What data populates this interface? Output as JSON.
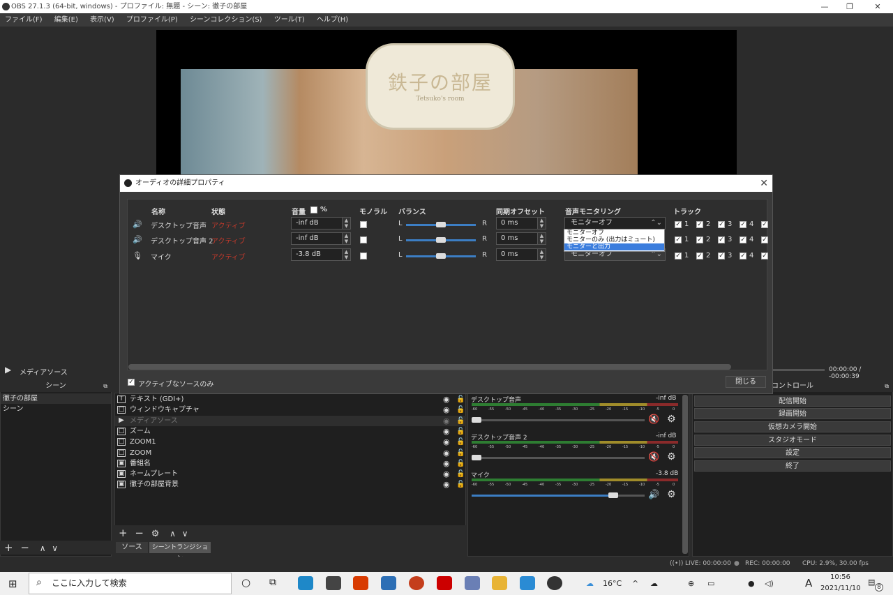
{
  "window": {
    "title": "OBS 27.1.3 (64-bit, windows) - プロファイル: 無題 - シーン: 徹子の部屋",
    "min": "—",
    "max": "❐",
    "close": "✕"
  },
  "menu": [
    "ファイル(F)",
    "編集(E)",
    "表示(V)",
    "プロファイル(P)",
    "シーンコレクション(S)",
    "ツール(T)",
    "ヘルプ(H)"
  ],
  "preview": {
    "logo_title": "鉄子の部屋",
    "logo_sub": "Tetsuko's room"
  },
  "dialog": {
    "title": "オーディオの詳細プロパティ",
    "close_icon": "✕",
    "headers": {
      "name": "名称",
      "status": "状態",
      "volume": "音量",
      "percent": "%",
      "mono": "モノラル",
      "balance": "バランス",
      "sync": "同期オフセット",
      "monitor": "音声モニタリング",
      "tracks": "トラック"
    },
    "rows": [
      {
        "icon": "speaker-icon",
        "name": "デスクトップ音声",
        "status": "アクティブ",
        "volume": "-inf dB",
        "bal_l": "L",
        "bal_r": "R",
        "balance": 0.5,
        "sync": "0 ms",
        "monitor": "モニターオフ",
        "tracks": [
          "1",
          "2",
          "3",
          "4"
        ]
      },
      {
        "icon": "speaker-icon",
        "name": "デスクトップ音声 2",
        "status": "アクティブ",
        "volume": "-inf dB",
        "bal_l": "L",
        "bal_r": "R",
        "balance": 0.5,
        "sync": "0 ms",
        "monitor": "",
        "tracks": [
          "1",
          "2",
          "3",
          "4"
        ]
      },
      {
        "icon": "mic-icon",
        "name": "マイク",
        "status": "アクティブ",
        "volume": "-3.8 dB",
        "bal_l": "L",
        "bal_r": "R",
        "balance": 0.5,
        "sync": "0 ms",
        "monitor": "モニターオフ",
        "tracks": [
          "1",
          "2",
          "3",
          "4"
        ]
      }
    ],
    "dropdown_options": [
      "モニターオフ",
      "モニターのみ (出力はミュート)",
      "モニターと出力"
    ],
    "dropdown_selected": "モニターと出力",
    "active_only_label": "アクティブなソースのみ",
    "close_button": "閉じる"
  },
  "media": {
    "name": "メディアソース",
    "time": "00:00:00 / -00:00:39"
  },
  "scenes": {
    "header": "シーン",
    "items": [
      "徹子の部屋",
      "シーン"
    ]
  },
  "sources": {
    "items": [
      {
        "icon": "T",
        "label": "テキスト (GDI+)"
      },
      {
        "icon": "□",
        "label": "ウィンドウキャプチャ"
      },
      {
        "icon": "▶",
        "label": "メディアソース",
        "hidden": true
      },
      {
        "icon": "□",
        "label": "ズーム"
      },
      {
        "icon": "□",
        "label": "ZOOM1"
      },
      {
        "icon": "□",
        "label": "ZOOM"
      },
      {
        "icon": "▣",
        "label": "番組名"
      },
      {
        "icon": "▣",
        "label": "ネームプレート"
      },
      {
        "icon": "▣",
        "label": "徹子の部屋背景"
      }
    ],
    "tab_sources": "ソース",
    "tab_transitions": "シーントランジション"
  },
  "mixer": {
    "ticks": [
      "-60",
      "-55",
      "-50",
      "-45",
      "-40",
      "-35",
      "-30",
      "-25",
      "-20",
      "-15",
      "-10",
      "-5",
      "0"
    ],
    "channels": [
      {
        "name": "デスクトップ音声",
        "value": "-inf dB",
        "level": 0.0,
        "muted": true
      },
      {
        "name": "デスクトップ音声 2",
        "value": "-inf dB",
        "level": 0.0,
        "muted": true
      },
      {
        "name": "マイク",
        "value": "-3.8 dB",
        "level": 0.82,
        "muted": false
      }
    ]
  },
  "controls": {
    "header": "コントロール",
    "buttons": [
      "配信開始",
      "録画開始",
      "仮想カメラ開始",
      "スタジオモード",
      "設定",
      "終了"
    ]
  },
  "status": {
    "live": "LIVE: 00:00:00",
    "rec": "REC: 00:00:00",
    "cpu": "CPU: 2.9%, 30.00 fps"
  },
  "taskbar": {
    "search": "ここに入力して検索",
    "temp": "16°C",
    "time": "10:56",
    "date": "2021/11/10",
    "ime": "A",
    "notif": "8"
  }
}
